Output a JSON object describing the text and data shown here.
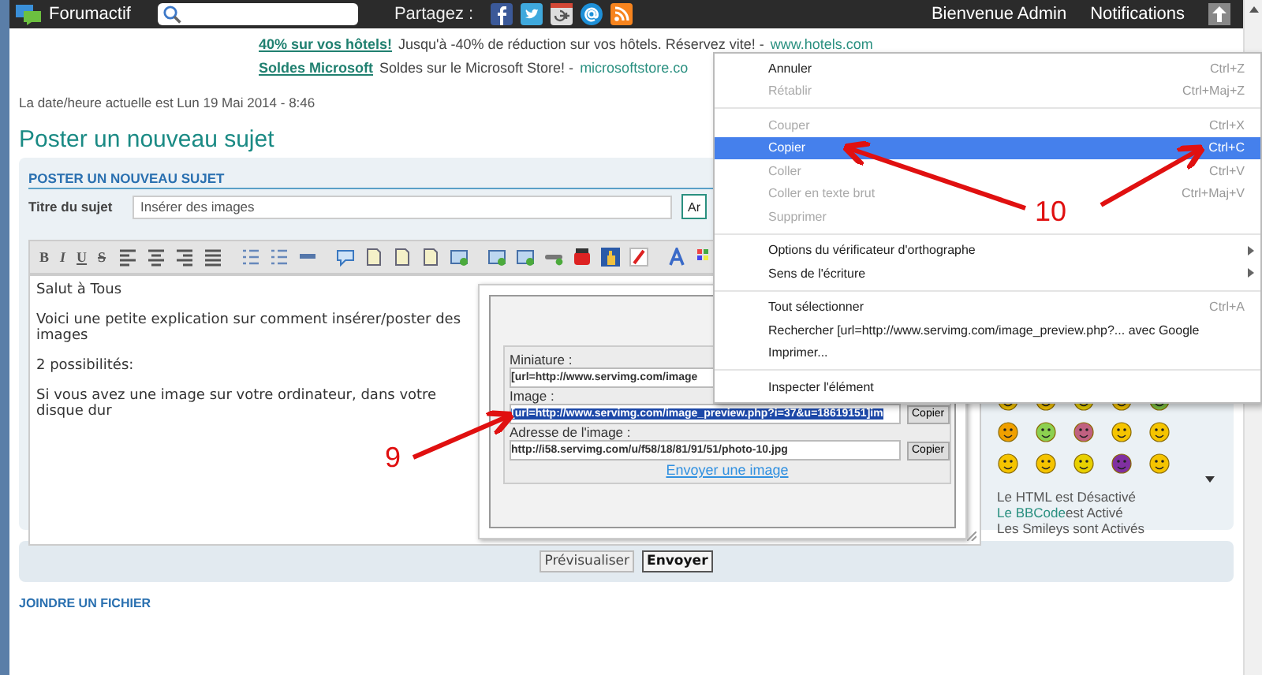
{
  "topbar": {
    "brand": "Forumactif",
    "share_label": "Partagez :",
    "welcome": "Bienvenue Admin",
    "notifications": "Notifications"
  },
  "ads": [
    {
      "link": "40% sur vos hôtels!",
      "text": "Jusqu'à -40% de réduction sur vos hôtels. Réservez vite! -",
      "url": "www.hotels.com"
    },
    {
      "link": "Soldes Microsoft",
      "text": "Soldes sur le Microsoft Store! -",
      "url": "microsoftstore.co"
    }
  ],
  "datetime": "La date/heure actuelle est Lun 19 Mai 2014 - 8:46",
  "page_title": "Poster un nouveau sujet",
  "form": {
    "heading": "POSTER UN NOUVEAU SUJET",
    "subject_label": "Titre du sujet",
    "subject_value": "Insérer des images",
    "side_button": "Ar"
  },
  "toolbar_format": [
    "B",
    "I",
    "U",
    "S"
  ],
  "editor_lines": [
    "Salut à Tous",
    "Voici une petite explication sur comment insérer/poster des images",
    "2 possibilités:",
    "Si vous avez une image sur votre ordinateur, dans votre disque dur"
  ],
  "status_lines": [
    {
      "text": "Le HTML est Désactivé"
    },
    {
      "link": "Le BBCode",
      "text": "est Activé"
    },
    {
      "text": "Les Smileys sont Activés"
    }
  ],
  "buttons": [
    {
      "label": "Prévisualiser",
      "primary": false
    },
    {
      "label": "Envoyer",
      "primary": true
    }
  ],
  "attach_heading": "JOINDRE UN FICHIER",
  "image_popup": {
    "fields": [
      {
        "label": "Miniature :",
        "value": "[url=http://www.servimg.com/image",
        "selected": false
      },
      {
        "label": "Image :",
        "value": "[url=http://www.servimg.com/image_preview.php?i=37&u=18619151]im",
        "selected": true,
        "copy": "Copier"
      },
      {
        "label": "Adresse de l'image :",
        "value": "http://i58.servimg.com/u/f58/18/81/91/51/photo-10.jpg",
        "selected": false,
        "copy": "Copier"
      }
    ],
    "link": "Envoyer une image"
  },
  "context_menu": [
    [
      {
        "label": "Annuler",
        "shortcut": "Ctrl+Z",
        "disabled": false,
        "selected": false,
        "submenu": false
      },
      {
        "label": "Rétablir",
        "shortcut": "Ctrl+Maj+Z",
        "disabled": true,
        "selected": false,
        "submenu": false
      }
    ],
    [
      {
        "label": "Couper",
        "shortcut": "Ctrl+X",
        "disabled": true,
        "selected": false,
        "submenu": false
      },
      {
        "label": "Copier",
        "shortcut": "Ctrl+C",
        "disabled": false,
        "selected": true,
        "submenu": false
      },
      {
        "label": "Coller",
        "shortcut": "Ctrl+V",
        "disabled": true,
        "selected": false,
        "submenu": false
      },
      {
        "label": "Coller en texte brut",
        "shortcut": "Ctrl+Maj+V",
        "disabled": true,
        "selected": false,
        "submenu": false
      },
      {
        "label": "Supprimer",
        "disabled": true,
        "selected": false,
        "submenu": false
      }
    ],
    [
      {
        "label": "Options du vérificateur d'orthographe",
        "disabled": false,
        "selected": false,
        "submenu": true
      },
      {
        "label": "Sens de l'écriture",
        "disabled": false,
        "selected": false,
        "submenu": true
      }
    ],
    [
      {
        "label": "Tout sélectionner",
        "shortcut": "Ctrl+A",
        "disabled": false,
        "selected": false,
        "submenu": false
      },
      {
        "label": "Rechercher [url=http://www.servimg.com/image_preview.php?... avec Google",
        "disabled": false,
        "selected": false,
        "submenu": false
      },
      {
        "label": "Imprimer...",
        "disabled": false,
        "selected": false,
        "submenu": false
      }
    ],
    [
      {
        "label": "Inspecter l'élément",
        "disabled": false,
        "selected": false,
        "submenu": false
      }
    ]
  ],
  "annotations": [
    {
      "label": "9"
    },
    {
      "label": "10"
    }
  ]
}
